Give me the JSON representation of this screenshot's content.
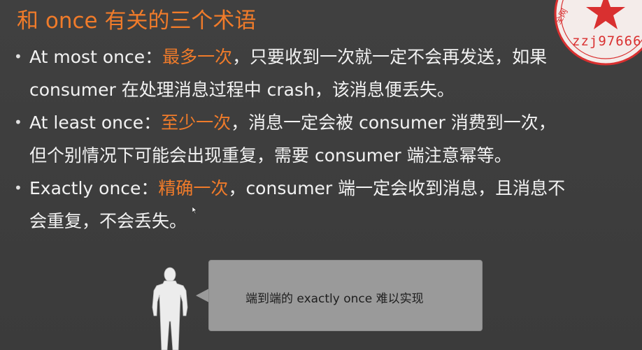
{
  "title": "和 once 有关的三个术语",
  "bullets": [
    {
      "lead": "At most once：",
      "highlight": "最多一次",
      "line1_rest": "，只要收到一次就一定不会再发送，如果",
      "line2": "consumer 在处理消息过程中 crash，该消息便丢失。"
    },
    {
      "lead": "At least once：",
      "highlight": "至少一次",
      "line1_rest": "，消息一定会被 consumer 消费到一次，",
      "line2": "但个别情况下可能会出现重复，需要 consumer 端注意幂等。"
    },
    {
      "lead": "Exactly once：",
      "highlight": "精确一次",
      "line1_rest": "，consumer 端一定会收到消息，且消息不",
      "line2": "会重复，不会丢失。"
    }
  ],
  "callout": {
    "text": "端到端的 exactly once 难以实现"
  },
  "watermark": {
    "label": "zzj97666",
    "seal_text": "全网"
  },
  "colors": {
    "background": "#3d3d3d",
    "accent": "#f07b2a",
    "text": "#f2f2f2",
    "callout_bg": "#9a9a9a",
    "seal_red": "#d93030"
  }
}
